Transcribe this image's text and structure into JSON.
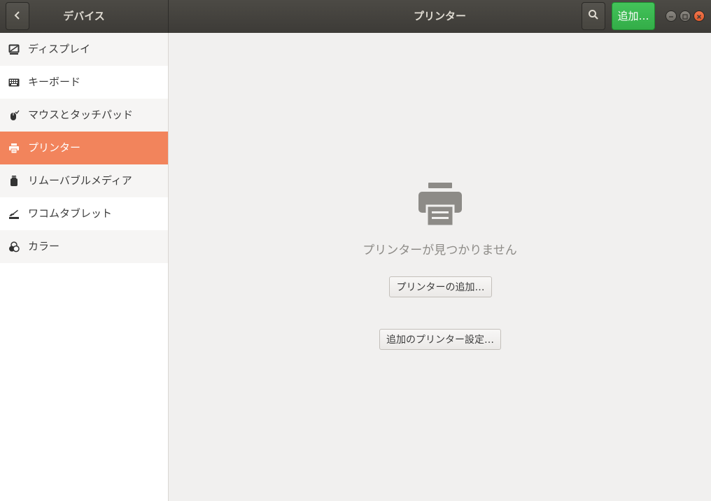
{
  "header": {
    "sidebar_title": "デバイス",
    "main_title": "プリンター",
    "add_label": "追加…",
    "icons": [
      "chevron-left-icon",
      "search-icon",
      "minimize-icon",
      "maximize-icon",
      "close-icon"
    ]
  },
  "sidebar": {
    "items": [
      {
        "label": "ディスプレイ",
        "icon": "display-icon"
      },
      {
        "label": "キーボード",
        "icon": "keyboard-icon"
      },
      {
        "label": "マウスとタッチパッド",
        "icon": "mouse-icon"
      },
      {
        "label": "プリンター",
        "icon": "printer-icon",
        "selected": true
      },
      {
        "label": "リムーバブルメディア",
        "icon": "usb-drive-icon"
      },
      {
        "label": "ワコムタブレット",
        "icon": "tablet-icon"
      },
      {
        "label": "カラー",
        "icon": "color-icon"
      }
    ]
  },
  "main": {
    "empty_message": "プリンターが見つかりません",
    "add_printer_button": "プリンターの追加…",
    "more_settings_button": "追加のプリンター設定…"
  },
  "colors": {
    "accent": "#f2845c",
    "add_button": "#38b34e",
    "header_bg": "#3d3b37"
  }
}
